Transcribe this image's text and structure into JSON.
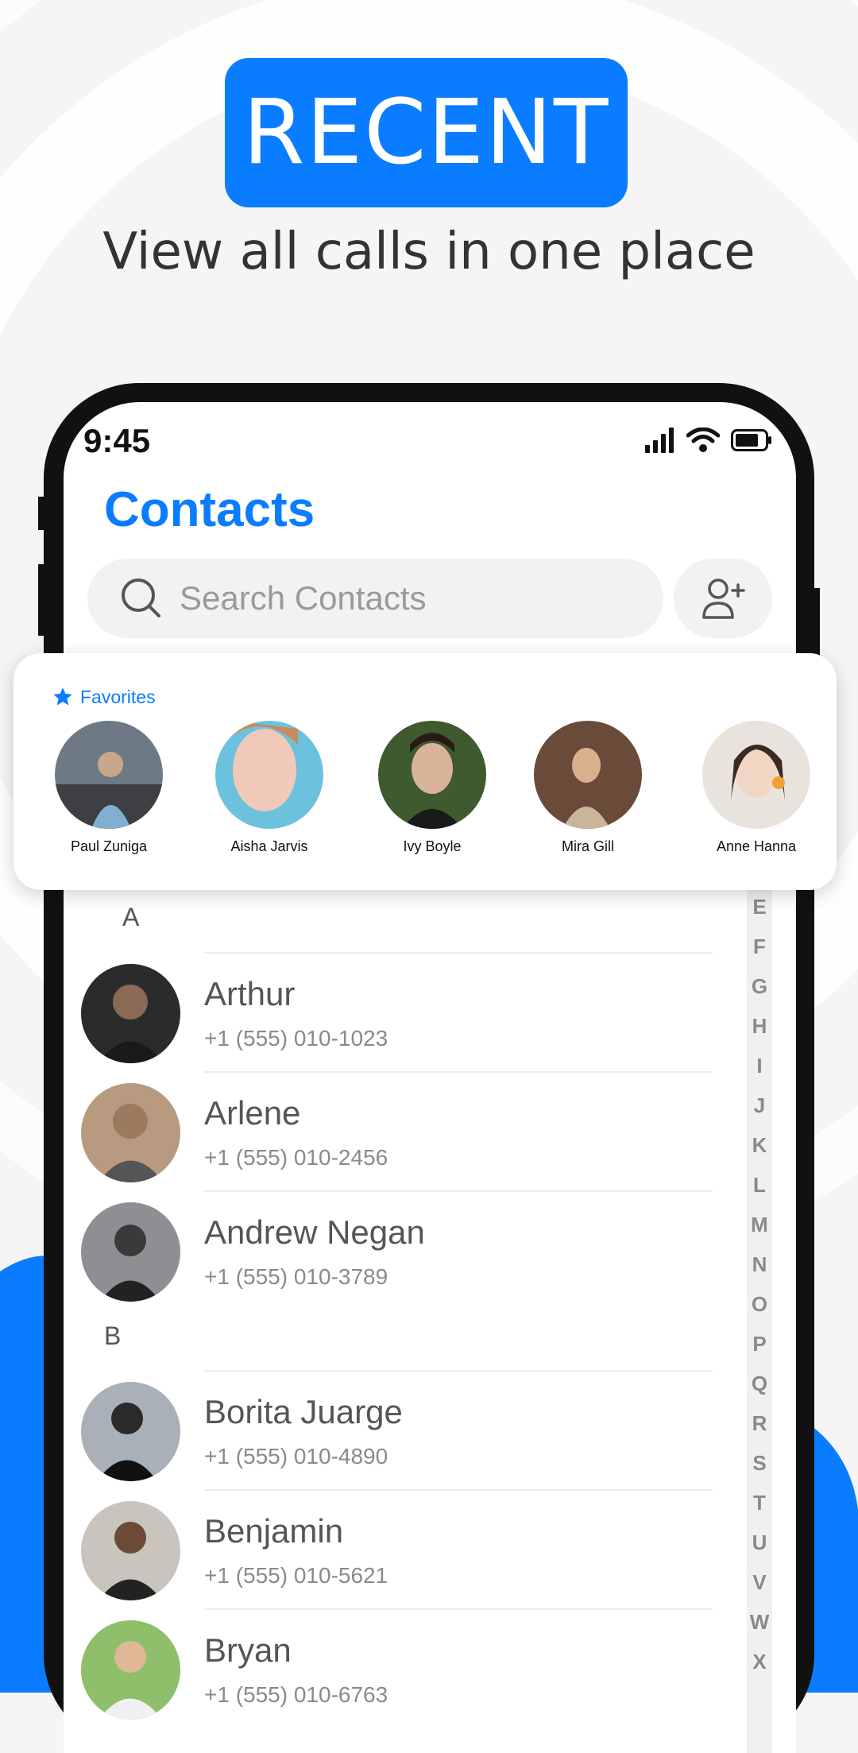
{
  "banner": {
    "title": "RECENT"
  },
  "subtitle": "View all calls in one place",
  "status": {
    "time": "9:45"
  },
  "page_title": "Contacts",
  "search": {
    "placeholder": "Search Contacts"
  },
  "favorites": {
    "label": "Favorites",
    "items": [
      {
        "name": "Paul Zuniga"
      },
      {
        "name": "Aisha Jarvis"
      },
      {
        "name": "Ivy Boyle"
      },
      {
        "name": "Mira Gill"
      },
      {
        "name": "Anne Hanna"
      }
    ]
  },
  "sections": [
    {
      "letter": "A",
      "contacts": [
        {
          "name": "Arthur",
          "phone": "+1 (555) 010-1023"
        },
        {
          "name": "Arlene",
          "phone": "+1 (555) 010-2456"
        },
        {
          "name": "Andrew Negan",
          "phone": "+1 (555) 010-3789"
        }
      ]
    },
    {
      "letter": "B",
      "contacts": [
        {
          "name": "Borita Juarge",
          "phone": "+1 (555) 010-4890"
        },
        {
          "name": "Benjamin",
          "phone": "+1 (555) 010-5621"
        },
        {
          "name": "Bryan",
          "phone": "+1 (555) 010-6763"
        }
      ]
    }
  ],
  "alphabet": [
    "E",
    "F",
    "G",
    "H",
    "I",
    "J",
    "K",
    "L",
    "M",
    "N",
    "O",
    "P",
    "Q",
    "R",
    "S",
    "T",
    "U",
    "V",
    "W",
    "X"
  ],
  "colors": {
    "accent": "#0a7cff",
    "background": "#f5f5f5"
  }
}
